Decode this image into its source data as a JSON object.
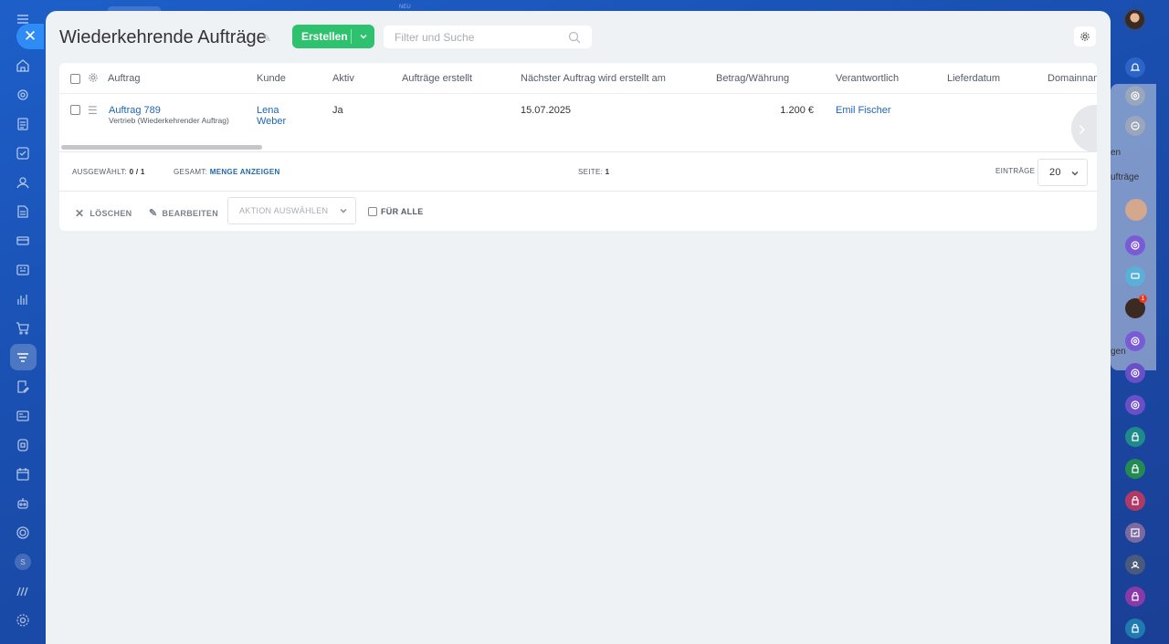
{
  "topbar": {
    "new_label": "NEU"
  },
  "page": {
    "title": "Wiederkehrende Aufträge"
  },
  "toolbar": {
    "create_label": "Erstellen",
    "search_placeholder": "Filter und Suche"
  },
  "grid": {
    "columns": [
      "Auftrag",
      "Kunde",
      "Aktiv",
      "Aufträge erstellt",
      "Nächster Auftrag wird erstellt am",
      "Betrag/Währung",
      "Verantwortlich",
      "Lieferdatum",
      "Domainnam"
    ],
    "rows": [
      {
        "order": "Auftrag 789",
        "order_sub": "Vertrieb (Wiederkehrender Auftrag)",
        "customer": "Lena Weber",
        "active": "Ja",
        "orders_created": "",
        "next_order_date": "15.07.2025",
        "amount": "1.200 €",
        "responsible": "Emil Fischer",
        "delivery_date": "",
        "domain": ""
      }
    ]
  },
  "footer": {
    "selected_label": "AUSGEWÄHLT:",
    "selected_value": "0 / 1",
    "total_label": "GESAMT:",
    "total_link": "MENGE ANZEIGEN",
    "page_label": "SEITE:",
    "page_value": "1",
    "entries_label": "EINTRÄGE",
    "entries_value": "20"
  },
  "actions": {
    "delete_label": "LÖSCHEN",
    "edit_label": "BEARBEITEN",
    "select_action_label": "AKTION AUSWÄHLEN",
    "for_all_label": "FÜR ALLE"
  },
  "right_panel": {
    "partial_text_1": "en",
    "partial_text_2": "ufträge",
    "partial_text_3": "gen",
    "notification_badge": "1"
  },
  "sidebar": {
    "counter_label": "S"
  }
}
